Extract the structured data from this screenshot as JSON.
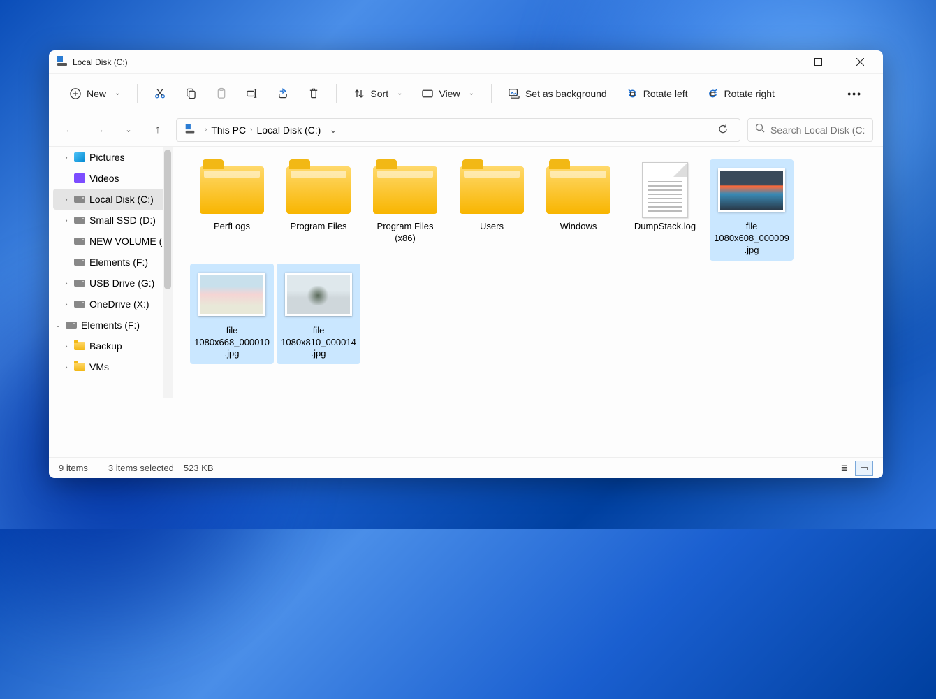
{
  "window": {
    "title": "Local Disk (C:)"
  },
  "toolbar": {
    "new": "New",
    "sort": "Sort",
    "view": "View",
    "set_bg": "Set as background",
    "rotate_left": "Rotate left",
    "rotate_right": "Rotate right"
  },
  "breadcrumb": {
    "parts": [
      "This PC",
      "Local Disk (C:)"
    ]
  },
  "search": {
    "placeholder": "Search Local Disk (C:)"
  },
  "sidebar": {
    "items": [
      {
        "label": "Pictures",
        "icon": "pic",
        "chev": "right"
      },
      {
        "label": "Videos",
        "icon": "vid",
        "chev": ""
      },
      {
        "label": "Local Disk (C:)",
        "icon": "drive",
        "chev": "right",
        "active": true
      },
      {
        "label": "Small SSD (D:)",
        "icon": "drive",
        "chev": "right"
      },
      {
        "label": "NEW VOLUME (",
        "icon": "drive",
        "chev": ""
      },
      {
        "label": "Elements (F:)",
        "icon": "drive",
        "chev": ""
      },
      {
        "label": "USB Drive (G:)",
        "icon": "drive",
        "chev": "right"
      },
      {
        "label": "OneDrive (X:)",
        "icon": "drive",
        "chev": "right"
      },
      {
        "label": "Elements (F:)",
        "icon": "drive",
        "chev": "down",
        "indent": -1
      },
      {
        "label": "Backup",
        "icon": "folder",
        "chev": "right"
      },
      {
        "label": "VMs",
        "icon": "folder",
        "chev": "right"
      }
    ]
  },
  "items": [
    {
      "name": "PerfLogs",
      "type": "folder"
    },
    {
      "name": "Program Files",
      "type": "folder"
    },
    {
      "name": "Program Files (x86)",
      "type": "folder"
    },
    {
      "name": "Users",
      "type": "folder"
    },
    {
      "name": "Windows",
      "type": "folder"
    },
    {
      "name": "DumpStack.log",
      "type": "doc"
    },
    {
      "name": "file 1080x608_000009.jpg",
      "type": "image",
      "thumb": "t1",
      "selected": true
    },
    {
      "name": "file 1080x668_000010.jpg",
      "type": "image",
      "thumb": "t2",
      "selected": true
    },
    {
      "name": "file 1080x810_000014.jpg",
      "type": "image",
      "thumb": "t3",
      "selected": true
    }
  ],
  "status": {
    "count": "9 items",
    "selection": "3 items selected",
    "size": "523 KB"
  }
}
